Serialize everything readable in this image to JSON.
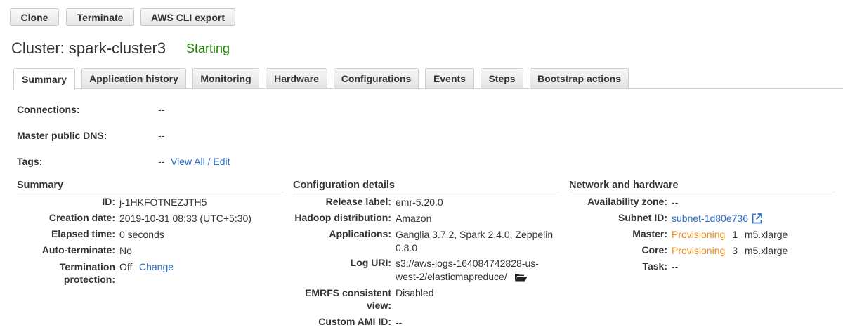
{
  "toolbar": {
    "clone_label": "Clone",
    "terminate_label": "Terminate",
    "cli_label": "AWS CLI export"
  },
  "header": {
    "cluster_title": "Cluster: spark-cluster3",
    "status": "Starting"
  },
  "tabs": [
    {
      "label": "Summary"
    },
    {
      "label": "Application history"
    },
    {
      "label": "Monitoring"
    },
    {
      "label": "Hardware"
    },
    {
      "label": "Configurations"
    },
    {
      "label": "Events"
    },
    {
      "label": "Steps"
    },
    {
      "label": "Bootstrap actions"
    }
  ],
  "top_info": {
    "connections_label": "Connections:",
    "connections_value": "--",
    "dns_label": "Master public DNS:",
    "dns_value": "--",
    "tags_label": "Tags:",
    "tags_value": "--",
    "tags_link": "View All / Edit"
  },
  "summary": {
    "heading": "Summary",
    "id_label": "ID:",
    "id_value": "j-1HKFOTNEZJTH5",
    "creation_label": "Creation date:",
    "creation_value": "2019-10-31 08:33 (UTC+5:30)",
    "elapsed_label": "Elapsed time:",
    "elapsed_value": "0 seconds",
    "autoterm_label": "Auto-terminate:",
    "autoterm_value": "No",
    "termprot_label_1": "Termination",
    "termprot_label_2": "protection:",
    "termprot_value": "Off",
    "termprot_link": "Change"
  },
  "config": {
    "heading": "Configuration details",
    "release_label": "Release label:",
    "release_value": "emr-5.20.0",
    "hadoop_label": "Hadoop distribution:",
    "hadoop_value": "Amazon",
    "apps_label": "Applications:",
    "apps_value_1": "Ganglia 3.7.2, Spark 2.4.0, Zeppelin",
    "apps_value_2": "0.8.0",
    "log_label": "Log URI:",
    "log_value_1": "s3://aws-logs-164084742828-us-",
    "log_value_2": "west-2/elasticmapreduce/",
    "emrfs_label_1": "EMRFS consistent",
    "emrfs_label_2": "view:",
    "emrfs_value": "Disabled",
    "ami_label": "Custom AMI ID:",
    "ami_value": "--"
  },
  "network": {
    "heading": "Network and hardware",
    "az_label": "Availability zone:",
    "az_value": "--",
    "subnet_label": "Subnet ID:",
    "subnet_value": "subnet-1d80e736",
    "master_label": "Master:",
    "master_status": "Provisioning",
    "master_count": "1",
    "master_type": "m5.xlarge",
    "core_label": "Core:",
    "core_status": "Provisioning",
    "core_count": "3",
    "core_type": "m5.xlarge",
    "task_label": "Task:",
    "task_value": "--"
  },
  "colors": {
    "status_green": "#1d8102",
    "link_blue": "#2e6fc4",
    "provisioning_orange": "#eb8c1e"
  }
}
